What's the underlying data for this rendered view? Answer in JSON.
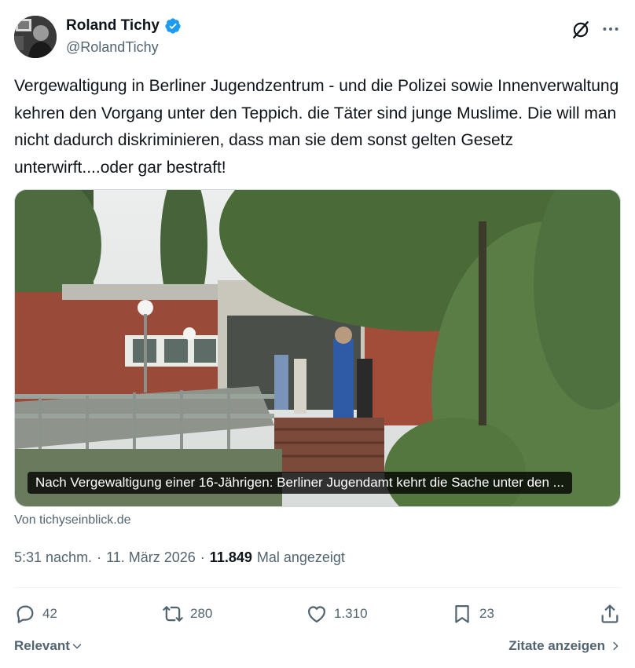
{
  "author": {
    "display_name": "Roland Tichy",
    "handle": "@RolandTichy",
    "verified": true
  },
  "tweet": {
    "text": "Vergewaltigung in Berliner Jugendzentrum - und die Polizei sowie Innenverwaltung kehren den Vorgang unter den Teppich. die Täter sind junge Muslime. Die will man nicht dadurch diskriminieren, dass man sie dem sonst gelten Gesetz unterwirft....oder gar bestraft!"
  },
  "card": {
    "caption": "Nach Vergewaltigung einer 16-Jährigen: Berliner Jugendamt kehrt die Sache unter den ...",
    "source": "Von tichyseinblick.de"
  },
  "meta": {
    "time": "5:31 nachm.",
    "date": "11. März 2026",
    "views": "11.849",
    "views_label": "Mal angezeigt",
    "separator": "·"
  },
  "actions": {
    "replies": "42",
    "reposts": "280",
    "likes": "1.310",
    "bookmarks": "23"
  },
  "footer": {
    "sort_label": "Relevant",
    "quotes_label": "Zitate anzeigen"
  },
  "colors": {
    "text": "#0f1419",
    "secondary": "#536471",
    "verified": "#1d9bf0",
    "divider": "#eff3f4"
  },
  "icons": [
    "grok-icon",
    "more-icon",
    "verified-badge-icon",
    "reply-icon",
    "repost-icon",
    "like-icon",
    "bookmark-icon",
    "share-icon",
    "chevron-down-icon",
    "chevron-right-icon"
  ]
}
